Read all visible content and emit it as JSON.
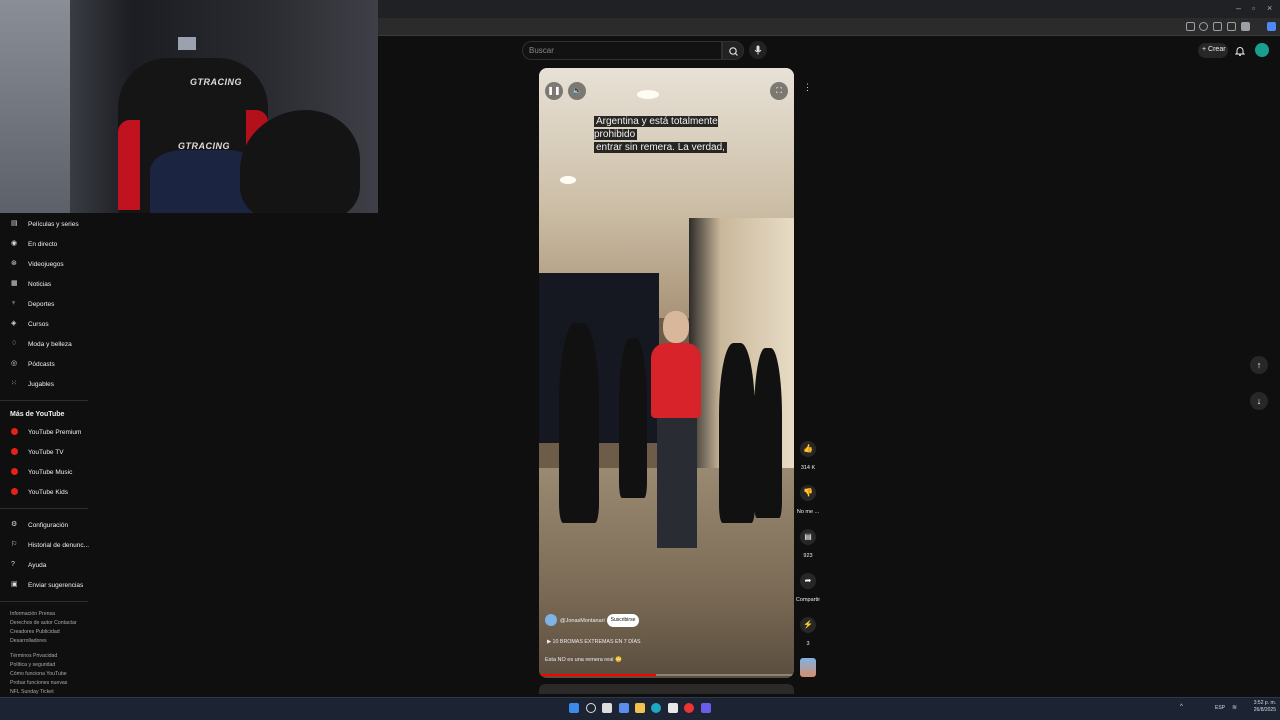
{
  "search": {
    "placeholder": "Buscar"
  },
  "header": {
    "create_label": "Crear"
  },
  "sidebar": {
    "items": [
      {
        "label": "Películas y series",
        "icon": "film-icon"
      },
      {
        "label": "En directo",
        "icon": "live-icon"
      },
      {
        "label": "Videojuegos",
        "icon": "gamepad-icon"
      },
      {
        "label": "Noticias",
        "icon": "news-icon"
      },
      {
        "label": "Deportes",
        "icon": "trophy-icon"
      },
      {
        "label": "Cursos",
        "icon": "lightbulb-icon"
      },
      {
        "label": "Moda y belleza",
        "icon": "hanger-icon"
      },
      {
        "label": "Pódcasts",
        "icon": "podcast-icon"
      },
      {
        "label": "Jugables",
        "icon": "grid-icon"
      }
    ],
    "more_heading": "Más de YouTube",
    "more_items": [
      {
        "label": "YouTube Premium"
      },
      {
        "label": "YouTube TV"
      },
      {
        "label": "YouTube Music"
      },
      {
        "label": "YouTube Kids"
      }
    ],
    "settings_items": [
      {
        "label": "Configuración",
        "icon": "gear-icon"
      },
      {
        "label": "Historial de denunc...",
        "icon": "flag-icon"
      },
      {
        "label": "Ayuda",
        "icon": "help-icon"
      },
      {
        "label": "Enviar sugerencias",
        "icon": "feedback-icon"
      }
    ],
    "footer_lines": [
      "Información  Prensa",
      "Derechos de autor  Contactar",
      "Creadores  Publicidad",
      "Desarrolladores",
      "Términos  Privacidad",
      "Política y seguridad",
      "Cómo funciona YouTube",
      "Probar funciones nuevas",
      "NFL Sunday Ticket"
    ]
  },
  "video": {
    "captions_line1": "Argentina y está totalmente prohibido",
    "captions_line2": "entrar sin remera. La verdad,",
    "channel": "@JonasMontanari",
    "subscribe_label": "Suscribirse",
    "playlist": "10 BROMAS EXTREMAS EN 7 DÍAS",
    "title": "Esta NO es una remera real 😳",
    "progress": 0.46,
    "webcam_logo": "GTRACING"
  },
  "actions": {
    "likes": "314 K",
    "dislike_label": "No me ...",
    "comments": "923",
    "share_label": "Compartir",
    "remix_count": "3"
  },
  "taskbar": {
    "language": "ESP",
    "time": "3:52 p. m.",
    "date": "26/8/2025"
  },
  "colors": {
    "accent_red": "#ff0000",
    "background": "#0f0f0f"
  }
}
